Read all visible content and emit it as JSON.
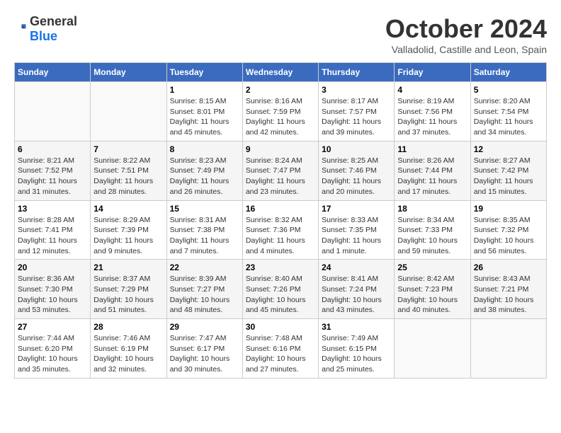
{
  "logo": {
    "text_general": "General",
    "text_blue": "Blue"
  },
  "header": {
    "month": "October 2024",
    "location": "Valladolid, Castille and Leon, Spain"
  },
  "weekdays": [
    "Sunday",
    "Monday",
    "Tuesday",
    "Wednesday",
    "Thursday",
    "Friday",
    "Saturday"
  ],
  "weeks": [
    [
      {
        "day": "",
        "sunrise": "",
        "sunset": "",
        "daylight": ""
      },
      {
        "day": "",
        "sunrise": "",
        "sunset": "",
        "daylight": ""
      },
      {
        "day": "1",
        "sunrise": "Sunrise: 8:15 AM",
        "sunset": "Sunset: 8:01 PM",
        "daylight": "Daylight: 11 hours and 45 minutes."
      },
      {
        "day": "2",
        "sunrise": "Sunrise: 8:16 AM",
        "sunset": "Sunset: 7:59 PM",
        "daylight": "Daylight: 11 hours and 42 minutes."
      },
      {
        "day": "3",
        "sunrise": "Sunrise: 8:17 AM",
        "sunset": "Sunset: 7:57 PM",
        "daylight": "Daylight: 11 hours and 39 minutes."
      },
      {
        "day": "4",
        "sunrise": "Sunrise: 8:19 AM",
        "sunset": "Sunset: 7:56 PM",
        "daylight": "Daylight: 11 hours and 37 minutes."
      },
      {
        "day": "5",
        "sunrise": "Sunrise: 8:20 AM",
        "sunset": "Sunset: 7:54 PM",
        "daylight": "Daylight: 11 hours and 34 minutes."
      }
    ],
    [
      {
        "day": "6",
        "sunrise": "Sunrise: 8:21 AM",
        "sunset": "Sunset: 7:52 PM",
        "daylight": "Daylight: 11 hours and 31 minutes."
      },
      {
        "day": "7",
        "sunrise": "Sunrise: 8:22 AM",
        "sunset": "Sunset: 7:51 PM",
        "daylight": "Daylight: 11 hours and 28 minutes."
      },
      {
        "day": "8",
        "sunrise": "Sunrise: 8:23 AM",
        "sunset": "Sunset: 7:49 PM",
        "daylight": "Daylight: 11 hours and 26 minutes."
      },
      {
        "day": "9",
        "sunrise": "Sunrise: 8:24 AM",
        "sunset": "Sunset: 7:47 PM",
        "daylight": "Daylight: 11 hours and 23 minutes."
      },
      {
        "day": "10",
        "sunrise": "Sunrise: 8:25 AM",
        "sunset": "Sunset: 7:46 PM",
        "daylight": "Daylight: 11 hours and 20 minutes."
      },
      {
        "day": "11",
        "sunrise": "Sunrise: 8:26 AM",
        "sunset": "Sunset: 7:44 PM",
        "daylight": "Daylight: 11 hours and 17 minutes."
      },
      {
        "day": "12",
        "sunrise": "Sunrise: 8:27 AM",
        "sunset": "Sunset: 7:42 PM",
        "daylight": "Daylight: 11 hours and 15 minutes."
      }
    ],
    [
      {
        "day": "13",
        "sunrise": "Sunrise: 8:28 AM",
        "sunset": "Sunset: 7:41 PM",
        "daylight": "Daylight: 11 hours and 12 minutes."
      },
      {
        "day": "14",
        "sunrise": "Sunrise: 8:29 AM",
        "sunset": "Sunset: 7:39 PM",
        "daylight": "Daylight: 11 hours and 9 minutes."
      },
      {
        "day": "15",
        "sunrise": "Sunrise: 8:31 AM",
        "sunset": "Sunset: 7:38 PM",
        "daylight": "Daylight: 11 hours and 7 minutes."
      },
      {
        "day": "16",
        "sunrise": "Sunrise: 8:32 AM",
        "sunset": "Sunset: 7:36 PM",
        "daylight": "Daylight: 11 hours and 4 minutes."
      },
      {
        "day": "17",
        "sunrise": "Sunrise: 8:33 AM",
        "sunset": "Sunset: 7:35 PM",
        "daylight": "Daylight: 11 hours and 1 minute."
      },
      {
        "day": "18",
        "sunrise": "Sunrise: 8:34 AM",
        "sunset": "Sunset: 7:33 PM",
        "daylight": "Daylight: 10 hours and 59 minutes."
      },
      {
        "day": "19",
        "sunrise": "Sunrise: 8:35 AM",
        "sunset": "Sunset: 7:32 PM",
        "daylight": "Daylight: 10 hours and 56 minutes."
      }
    ],
    [
      {
        "day": "20",
        "sunrise": "Sunrise: 8:36 AM",
        "sunset": "Sunset: 7:30 PM",
        "daylight": "Daylight: 10 hours and 53 minutes."
      },
      {
        "day": "21",
        "sunrise": "Sunrise: 8:37 AM",
        "sunset": "Sunset: 7:29 PM",
        "daylight": "Daylight: 10 hours and 51 minutes."
      },
      {
        "day": "22",
        "sunrise": "Sunrise: 8:39 AM",
        "sunset": "Sunset: 7:27 PM",
        "daylight": "Daylight: 10 hours and 48 minutes."
      },
      {
        "day": "23",
        "sunrise": "Sunrise: 8:40 AM",
        "sunset": "Sunset: 7:26 PM",
        "daylight": "Daylight: 10 hours and 45 minutes."
      },
      {
        "day": "24",
        "sunrise": "Sunrise: 8:41 AM",
        "sunset": "Sunset: 7:24 PM",
        "daylight": "Daylight: 10 hours and 43 minutes."
      },
      {
        "day": "25",
        "sunrise": "Sunrise: 8:42 AM",
        "sunset": "Sunset: 7:23 PM",
        "daylight": "Daylight: 10 hours and 40 minutes."
      },
      {
        "day": "26",
        "sunrise": "Sunrise: 8:43 AM",
        "sunset": "Sunset: 7:21 PM",
        "daylight": "Daylight: 10 hours and 38 minutes."
      }
    ],
    [
      {
        "day": "27",
        "sunrise": "Sunrise: 7:44 AM",
        "sunset": "Sunset: 6:20 PM",
        "daylight": "Daylight: 10 hours and 35 minutes."
      },
      {
        "day": "28",
        "sunrise": "Sunrise: 7:46 AM",
        "sunset": "Sunset: 6:19 PM",
        "daylight": "Daylight: 10 hours and 32 minutes."
      },
      {
        "day": "29",
        "sunrise": "Sunrise: 7:47 AM",
        "sunset": "Sunset: 6:17 PM",
        "daylight": "Daylight: 10 hours and 30 minutes."
      },
      {
        "day": "30",
        "sunrise": "Sunrise: 7:48 AM",
        "sunset": "Sunset: 6:16 PM",
        "daylight": "Daylight: 10 hours and 27 minutes."
      },
      {
        "day": "31",
        "sunrise": "Sunrise: 7:49 AM",
        "sunset": "Sunset: 6:15 PM",
        "daylight": "Daylight: 10 hours and 25 minutes."
      },
      {
        "day": "",
        "sunrise": "",
        "sunset": "",
        "daylight": ""
      },
      {
        "day": "",
        "sunrise": "",
        "sunset": "",
        "daylight": ""
      }
    ]
  ]
}
